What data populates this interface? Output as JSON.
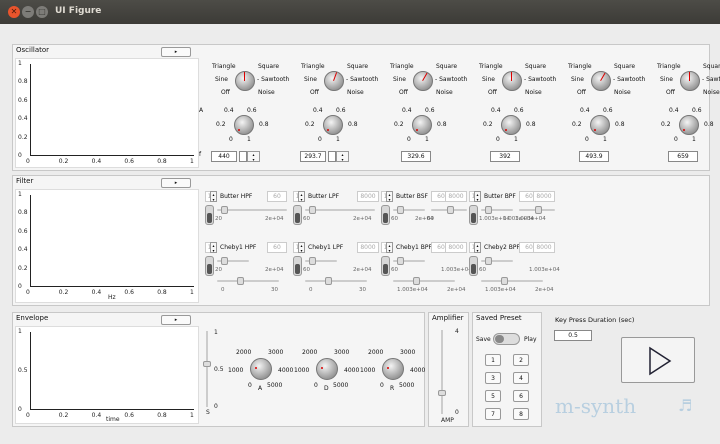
{
  "window": {
    "title": "UI Figure"
  },
  "osc": {
    "title": "Oscillator",
    "btn": "▸",
    "wave": {
      "triangle": "Triangle",
      "square": "Square",
      "sine": "Sine",
      "sawtooth": "- Sawtooth",
      "off": "Off",
      "noise": "Noise"
    },
    "amp": {
      "prefix": "A",
      "t04": "0.4",
      "t06": "0.6",
      "t02": "0.2",
      "t08": "0.8",
      "t0": "0",
      "t1": "1"
    },
    "fprefix": "f",
    "freqs": [
      "440",
      "293.7",
      "329.6",
      "392",
      "493.9",
      "659"
    ]
  },
  "filter": {
    "title": "Filter",
    "btn": "▸",
    "hz": "Hz",
    "row1": [
      {
        "name": "Butter HPF",
        "num": "1",
        "a": "60",
        "b": "",
        "l": "20",
        "r": "2e+04"
      },
      {
        "name": "Butter LPF",
        "num": "1",
        "a": "",
        "b": "8000",
        "l": "60",
        "r": "2e+04"
      },
      {
        "name": "Butter BSF",
        "num": "1",
        "a": "60",
        "b": "8000",
        "l": "60",
        "r": "2e+04",
        "l2": "60",
        "r2": "2e+04"
      },
      {
        "name": "Butter BPF",
        "num": "1",
        "a": "60",
        "b": "8000",
        "l": "1.003e+04",
        "r": "1.003e+04",
        "l2": "1.003e+04",
        "r2": "2e+04"
      }
    ],
    "row2": [
      {
        "name": "Cheby1 HPF",
        "num": "1",
        "a": "60",
        "b": "",
        "l": "20",
        "r": "2e+04",
        "l2": "0",
        "r2": "30"
      },
      {
        "name": "Cheby1 LPF",
        "num": "1",
        "a": "",
        "b": "8000",
        "l": "60",
        "r": "2e+04",
        "l2": "0",
        "r2": "30"
      },
      {
        "name": "Cheby1 BPF",
        "num": "1",
        "a": "60",
        "b": "8000",
        "l": "60",
        "r": "1.003e+04",
        "l2": "1.003e+04",
        "r2": "2e+04"
      },
      {
        "name": "Cheby2 BPF",
        "num": "1",
        "a": "60",
        "b": "8000",
        "l": "60",
        "r": "1.003e+04",
        "l2": "1.003e+04",
        "r2": "2e+04"
      }
    ]
  },
  "env": {
    "title": "Envelope",
    "btn": "▸",
    "xlabel": "time",
    "slabel": "S",
    "knobs": [
      {
        "name": "A",
        "t2000": "2000",
        "t3000": "3000",
        "t1000": "1000",
        "t4000": "4000",
        "t0": "0",
        "t5000": "5000"
      },
      {
        "name": "D",
        "t2000": "2000",
        "t3000": "3000",
        "t1000": "1000",
        "t4000": "4000",
        "t0": "0",
        "t5000": "5000"
      },
      {
        "name": "R",
        "t2000": "2000",
        "t3000": "3000",
        "t1000": "1000",
        "t4000": "4000",
        "t0": "0",
        "t5000": "5000"
      }
    ]
  },
  "amp": {
    "title": "Amplifier",
    "top": "4",
    "bot": "0",
    "label": "AMP"
  },
  "preset": {
    "title": "Saved Preset",
    "save": "Save",
    "play": "Play",
    "btns": [
      "1",
      "2",
      "3",
      "4",
      "5",
      "6",
      "7",
      "8"
    ]
  },
  "key": {
    "title": "Key Press Duration (sec)",
    "value": "0.5"
  },
  "logo": {
    "text": "m-synth",
    "note": "♬"
  },
  "ticks": {
    "x": [
      "0",
      "0.2",
      "0.4",
      "0.6",
      "0.8",
      "1"
    ],
    "y": [
      "1",
      "0.8",
      "0.6",
      "0.4",
      "0.2",
      "0"
    ],
    "env_y": [
      "1",
      "0.5",
      "0"
    ],
    "s": [
      "1",
      "0.5",
      "0"
    ]
  }
}
